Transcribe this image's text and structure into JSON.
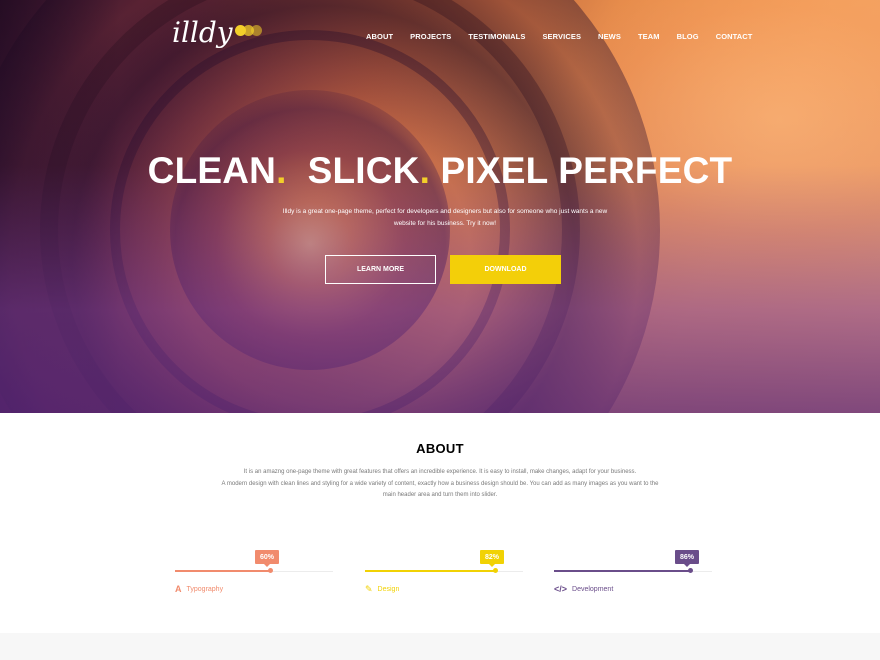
{
  "header": {
    "logo_text": "illdy",
    "nav": [
      "ABOUT",
      "PROJECTS",
      "TESTIMONIALS",
      "SERVICES",
      "NEWS",
      "TEAM",
      "BLOG",
      "CONTACT"
    ]
  },
  "hero": {
    "headline_part1": "CLEAN",
    "headline_part2": "SLICK",
    "headline_part3": "PIXEL PERFECT",
    "headline_dot": ".",
    "subtext": "Illdy is a great one-page theme, perfect for developers and designers but also for someone who just wants a new website for his business. Try it now!",
    "learn_more_label": "LEARN MORE",
    "download_label": "DOWNLOAD"
  },
  "about": {
    "title": "ABOUT",
    "text_line1": "It is an amazng one-page theme with great features that offers an incredible experience. It is easy to install, make changes, adapt for your business.",
    "text_line2": "A modern design with clean lines and styling for a wide variety of content, exactly how a business design should be. You can add as many images as you want to the main header area and turn them into slider.",
    "skills": [
      {
        "label": "Typography",
        "percent_label": "60%",
        "percent": 60,
        "color": "#f18b6d",
        "icon": "typography-icon",
        "glyph": "A"
      },
      {
        "label": "Design",
        "percent_label": "82%",
        "percent": 82,
        "color": "#f1d204",
        "icon": "pencil-icon",
        "glyph": "✎"
      },
      {
        "label": "Development",
        "percent_label": "86%",
        "percent": 86,
        "color": "#6a4d8a",
        "icon": "code-icon",
        "glyph": "</>"
      }
    ]
  },
  "colors": {
    "accent_yellow": "#f3cf09",
    "typography": "#f18b6d",
    "design": "#f1d204",
    "development": "#6a4d8a"
  }
}
